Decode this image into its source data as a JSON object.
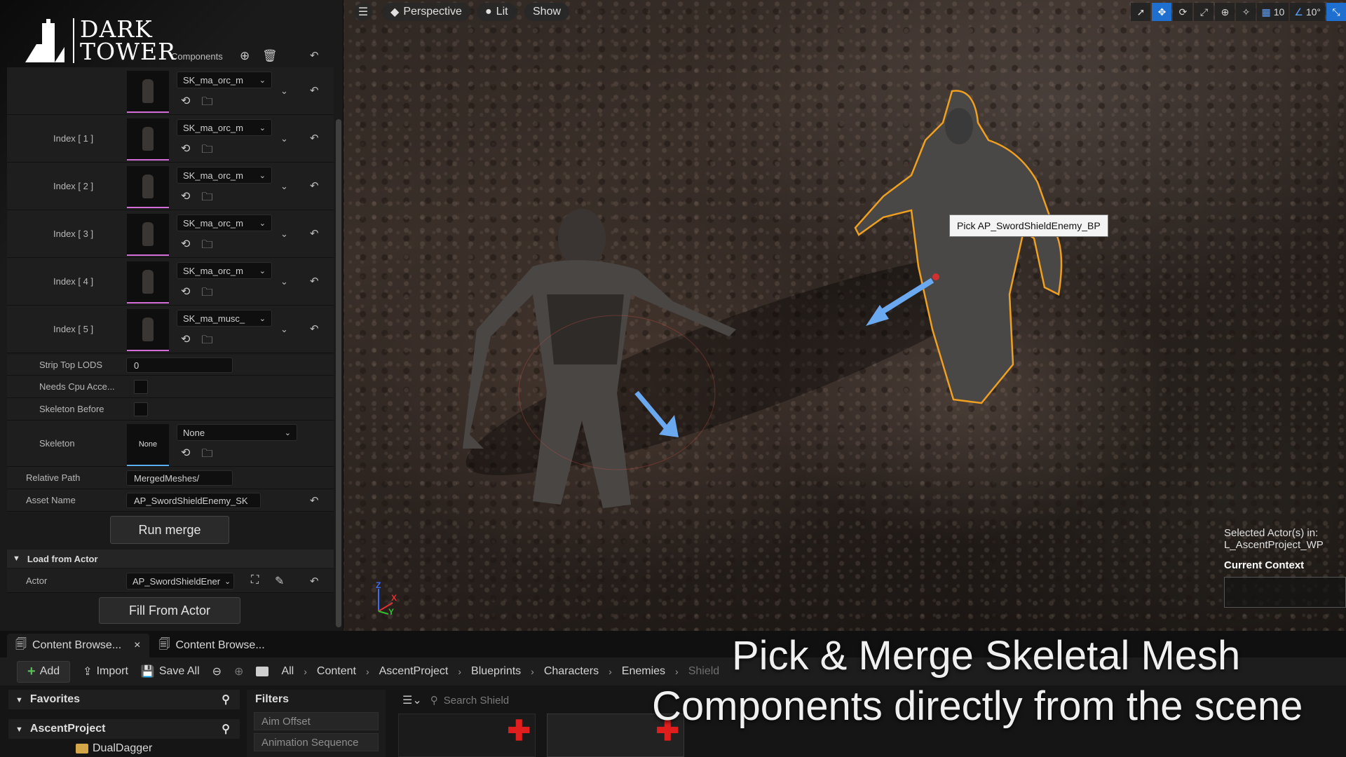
{
  "logo": {
    "line1": "DARK",
    "line2": "TOWER"
  },
  "viewport": {
    "perspective_label": "Perspective",
    "lit_label": "Lit",
    "show_label": "Show",
    "grid_value": "10",
    "angle_value": "10°",
    "tooltip": "Pick AP_SwordShieldEnemy_BP",
    "selected_actor_label": "Selected Actor(s) in:",
    "selected_actor_level": "L_AscentProject_WP",
    "current_context_label": "Current Context",
    "axis": {
      "z": "Z",
      "x": "X",
      "y": "Y"
    }
  },
  "details": {
    "section_partial": "Components",
    "mesh_rows": [
      {
        "label": "",
        "mesh": "SK_ma_orc_m"
      },
      {
        "label": "Index [ 1 ]",
        "mesh": "SK_ma_orc_m"
      },
      {
        "label": "Index [ 2 ]",
        "mesh": "SK_ma_orc_m"
      },
      {
        "label": "Index [ 3 ]",
        "mesh": "SK_ma_orc_m"
      },
      {
        "label": "Index [ 4 ]",
        "mesh": "SK_ma_orc_m"
      },
      {
        "label": "Index [ 5 ]",
        "mesh": "SK_ma_musc_"
      }
    ],
    "strip_top_lods_label": "Strip Top LODS",
    "strip_top_lods_value": "0",
    "needs_cpu_label": "Needs Cpu Acce...",
    "skeleton_before_label": "Skeleton Before",
    "skeleton_label": "Skeleton",
    "skeleton_thumb": "None",
    "skeleton_value": "None",
    "relative_path_label": "Relative Path",
    "relative_path_value": "MergedMeshes/",
    "asset_name_label": "Asset Name",
    "asset_name_value": "AP_SwordShieldEnemy_SK",
    "run_merge_label": "Run merge",
    "load_from_actor_label": "Load from Actor",
    "actor_label": "Actor",
    "actor_value": "AP_SwordShieldEner",
    "fill_from_actor_label": "Fill From Actor"
  },
  "content_browser": {
    "tabs": [
      "Content Browse...",
      "Content Browse..."
    ],
    "toolbar": {
      "add": "Add",
      "import": "Import",
      "save_all": "Save All"
    },
    "breadcrumbs": [
      "All",
      "Content",
      "AscentProject",
      "Blueprints",
      "Characters",
      "Enemies",
      "Shield"
    ],
    "favorites_label": "Favorites",
    "project_label": "AscentProject",
    "folder_item": "DualDagger",
    "filters_label": "Filters",
    "filter_items": [
      "Aim Offset",
      "Animation Sequence"
    ],
    "search_placeholder": "Search Shield"
  },
  "caption": {
    "line1": "Pick & Merge Skeletal Mesh",
    "line2": "Components directly from the scene"
  },
  "colors": {
    "accent_blue": "#1f6fd0",
    "selection_orange": "#f0a020",
    "thumb_underline": "#d36ed8",
    "add_green": "#58c058",
    "red_plus": "#e01e1e"
  }
}
